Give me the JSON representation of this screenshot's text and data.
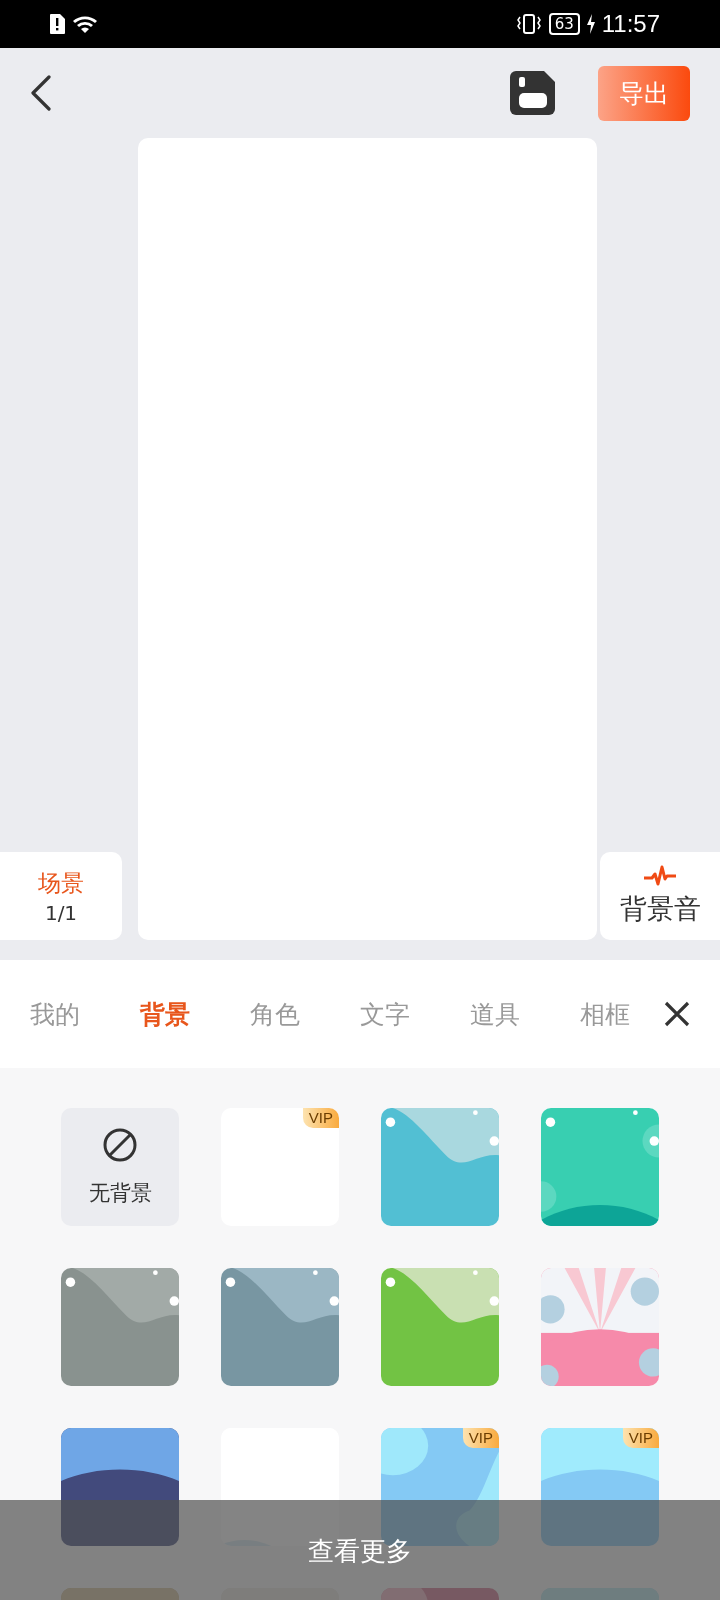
{
  "status_bar": {
    "time": "11:57",
    "battery": "63"
  },
  "toolbar": {
    "export_button": "导出"
  },
  "scene_card": {
    "title": "场景",
    "count": "1/1"
  },
  "music_card": {
    "label": "背景音"
  },
  "tabs": [
    {
      "label": "我的",
      "selected": false
    },
    {
      "label": "背景",
      "selected": true
    },
    {
      "label": "角色",
      "selected": false
    },
    {
      "label": "文字",
      "selected": false
    },
    {
      "label": "道具",
      "selected": false
    },
    {
      "label": "相框",
      "selected": false
    }
  ],
  "backgrounds": [
    {
      "kind": "none",
      "label": "无背景"
    },
    {
      "kind": "blank",
      "badge": "VIP"
    },
    {
      "kind": "picture"
    },
    {
      "kind": "picture"
    },
    {
      "kind": "picture"
    },
    {
      "kind": "picture"
    },
    {
      "kind": "picture"
    },
    {
      "kind": "picture"
    },
    {
      "kind": "picture"
    },
    {
      "kind": "picture"
    },
    {
      "kind": "picture",
      "badge": "VIP"
    },
    {
      "kind": "picture",
      "badge": "VIP"
    },
    {
      "kind": "picture"
    },
    {
      "kind": "picture"
    },
    {
      "kind": "picture"
    },
    {
      "kind": "picture"
    }
  ],
  "more_button": "查看更多"
}
